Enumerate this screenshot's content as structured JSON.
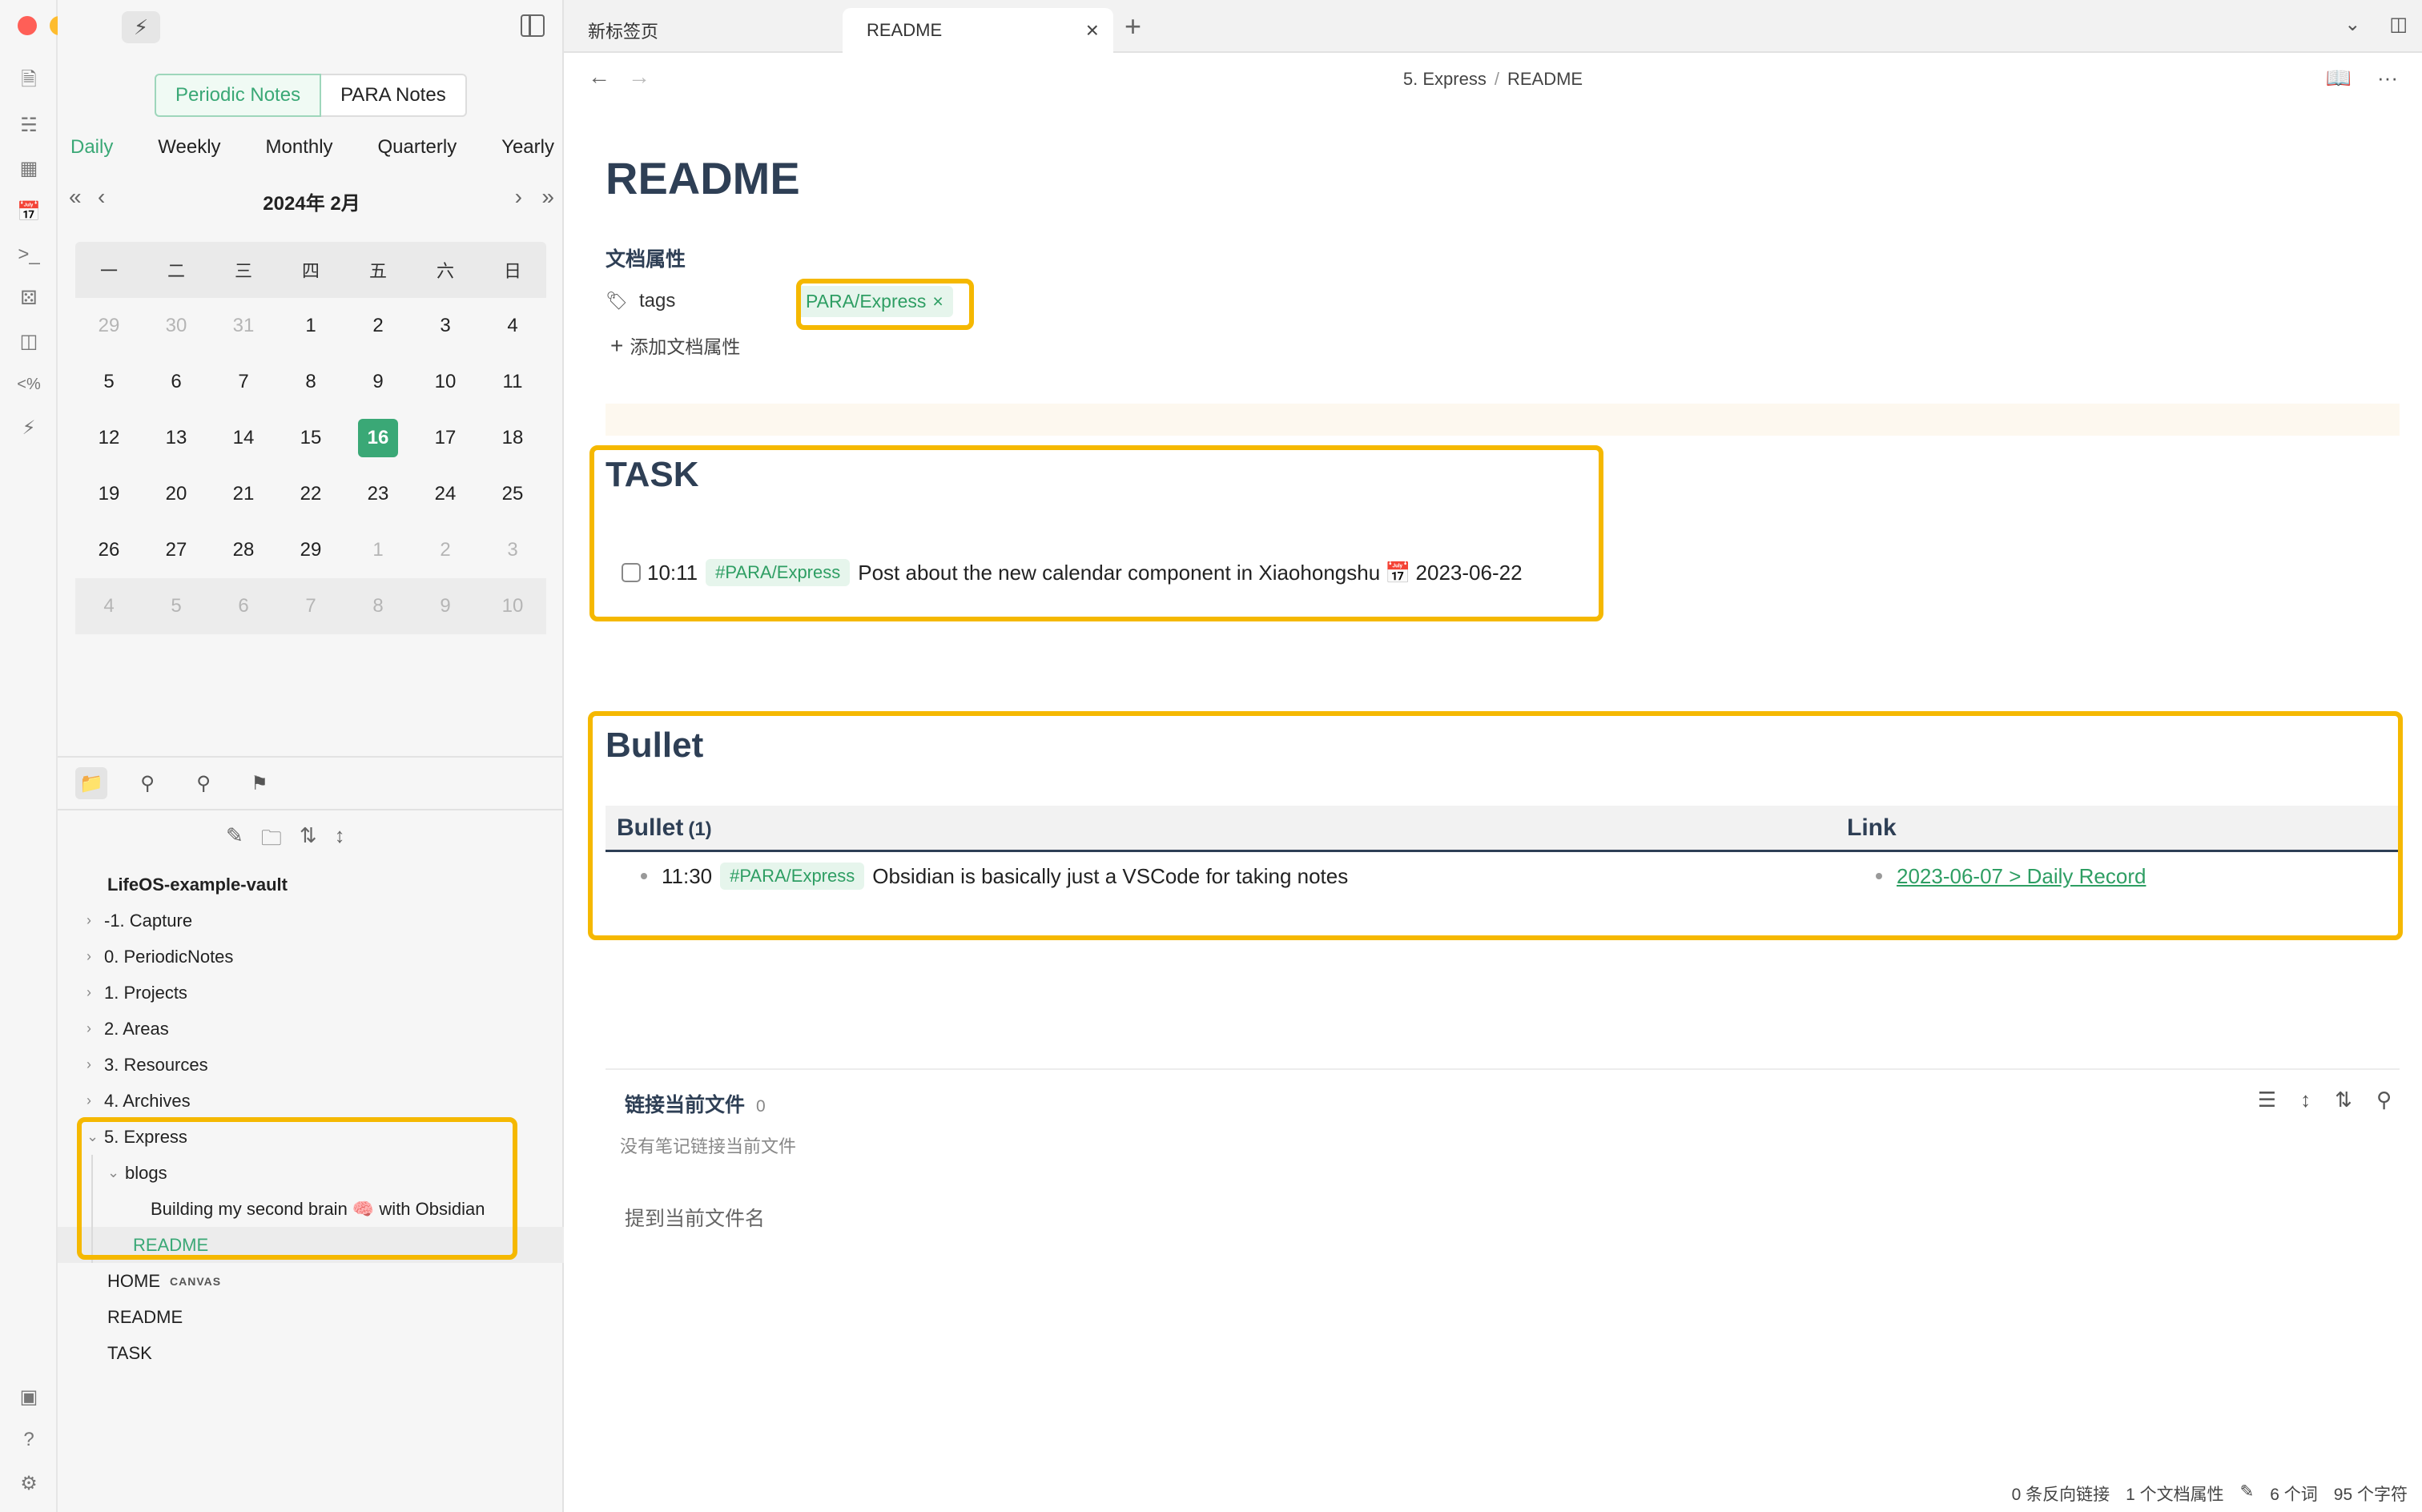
{
  "window": {
    "traffic_colors": [
      "#ff5f57",
      "#febc2e",
      "#28c840"
    ]
  },
  "ribbon": {
    "icons": [
      "files-icon",
      "graph-icon",
      "apps-icon",
      "calendar-icon",
      "terminal-icon",
      "dice-icon",
      "layout-icon",
      "template-icon",
      "bolt-icon"
    ],
    "bottom_icons": [
      "vault-icon",
      "help-icon",
      "settings-icon"
    ]
  },
  "sidebar": {
    "segment": {
      "periodic": "Periodic Notes",
      "para": "PARA Notes"
    },
    "periods": [
      "Daily",
      "Weekly",
      "Monthly",
      "Quarterly",
      "Yearly"
    ],
    "calendar": {
      "title": "2024年  2月",
      "weekdays": [
        "一",
        "二",
        "三",
        "四",
        "五",
        "六",
        "日"
      ],
      "rows": [
        [
          {
            "d": "29",
            "dim": true
          },
          {
            "d": "30",
            "dim": true
          },
          {
            "d": "31",
            "dim": true
          },
          {
            "d": "1"
          },
          {
            "d": "2"
          },
          {
            "d": "3"
          },
          {
            "d": "4"
          }
        ],
        [
          {
            "d": "5"
          },
          {
            "d": "6"
          },
          {
            "d": "7"
          },
          {
            "d": "8"
          },
          {
            "d": "9"
          },
          {
            "d": "10"
          },
          {
            "d": "11"
          }
        ],
        [
          {
            "d": "12"
          },
          {
            "d": "13"
          },
          {
            "d": "14"
          },
          {
            "d": "15"
          },
          {
            "d": "16",
            "today": true
          },
          {
            "d": "17"
          },
          {
            "d": "18"
          }
        ],
        [
          {
            "d": "19"
          },
          {
            "d": "20"
          },
          {
            "d": "21"
          },
          {
            "d": "22"
          },
          {
            "d": "23"
          },
          {
            "d": "24"
          },
          {
            "d": "25"
          }
        ],
        [
          {
            "d": "26"
          },
          {
            "d": "27"
          },
          {
            "d": "28"
          },
          {
            "d": "29"
          },
          {
            "d": "1",
            "dim": true
          },
          {
            "d": "2",
            "dim": true
          },
          {
            "d": "3",
            "dim": true
          }
        ],
        [
          {
            "d": "4",
            "dim": true
          },
          {
            "d": "5",
            "dim": true
          },
          {
            "d": "6",
            "dim": true
          },
          {
            "d": "7",
            "dim": true
          },
          {
            "d": "8",
            "dim": true
          },
          {
            "d": "9",
            "dim": true
          },
          {
            "d": "10",
            "dim": true
          }
        ]
      ]
    },
    "tree": [
      {
        "label": "LifeOS-example-vault",
        "level": 0,
        "vault": true
      },
      {
        "label": "-1. Capture",
        "level": 1,
        "chev": "›"
      },
      {
        "label": "0. PeriodicNotes",
        "level": 1,
        "chev": "›"
      },
      {
        "label": "1. Projects",
        "level": 1,
        "chev": "›"
      },
      {
        "label": "2. Areas",
        "level": 1,
        "chev": "›"
      },
      {
        "label": "3. Resources",
        "level": 1,
        "chev": "›"
      },
      {
        "label": "4. Archives",
        "level": 1,
        "chev": "›"
      },
      {
        "label": "5. Express",
        "level": 1,
        "chev": "⌄"
      },
      {
        "label": "blogs",
        "level": 2,
        "chev": "⌄"
      },
      {
        "label": "Building my second brain 🧠 with Obsidian",
        "level": 3
      },
      {
        "label": "README",
        "level": 2,
        "selected": true
      },
      {
        "label": "HOME",
        "level": 0.5,
        "badge": "CANVAS"
      },
      {
        "label": "README",
        "level": 0.5
      },
      {
        "label": "TASK",
        "level": 0.5
      }
    ]
  },
  "tabs": {
    "t1": "新标签页",
    "t2": "README"
  },
  "breadcrumb": {
    "folder": "5. Express",
    "sep": "/",
    "file": "README"
  },
  "doc": {
    "title": "README",
    "props_heading": "文档属性",
    "prop_name": "tags",
    "prop_value": "PARA/Express",
    "add_prop": "添加文档属性",
    "task_heading": "TASK",
    "task": {
      "time": "10:11",
      "tag": "#PARA/Express",
      "text": "Post about the new calendar component in Xiaohongshu",
      "date_emoji": "📅",
      "date": "2023-06-22"
    },
    "bullet_heading": "Bullet",
    "table": {
      "col1": "Bullet",
      "count": "(1)",
      "col2": "Link",
      "row": {
        "time": "11:30",
        "tag": "#PARA/Express",
        "text": "Obsidian is basically just a VSCode for taking notes",
        "link": "2023-06-07 > Daily Record"
      }
    },
    "backlinks": {
      "title": "链接当前文件",
      "count": "0",
      "empty": "没有笔记链接当前文件",
      "mentions": "提到当前文件名"
    }
  },
  "status": {
    "backlinks": "0 条反向链接",
    "props": "1 个文档属性",
    "words": "6 个词",
    "chars": "95 个字符"
  },
  "accent": "#3aa876",
  "highlight": "#f5b800"
}
